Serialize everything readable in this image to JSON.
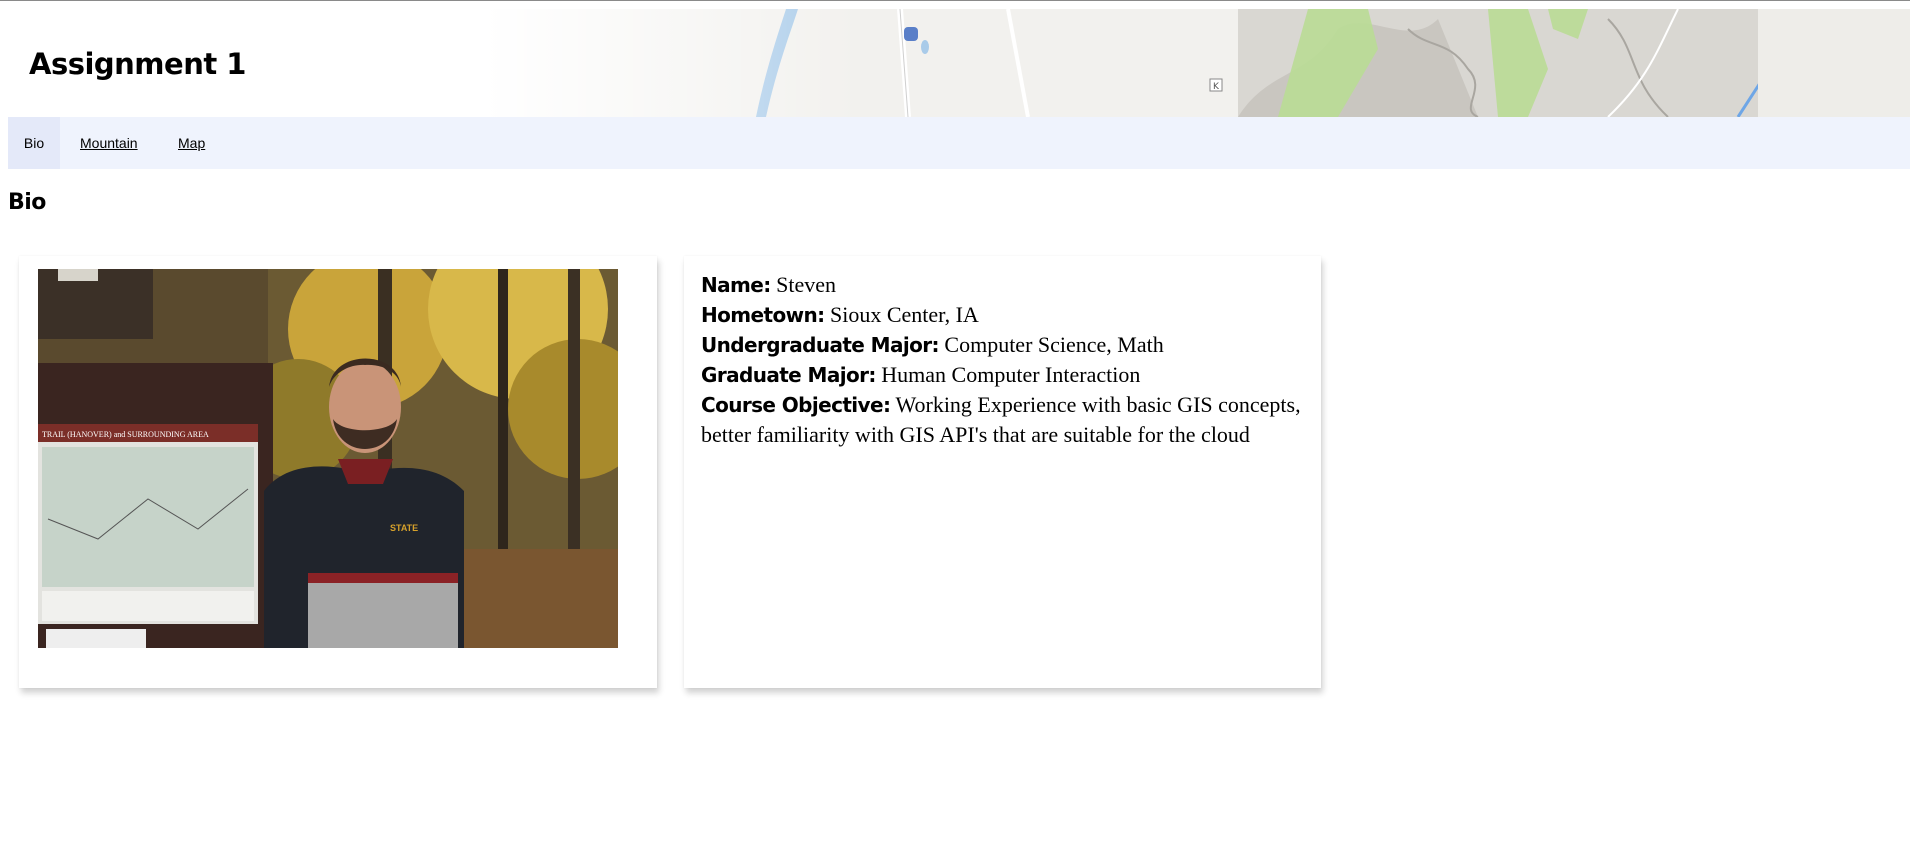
{
  "header": {
    "title": "Assignment 1",
    "map_label": "K"
  },
  "nav": {
    "items": [
      {
        "label": "Bio",
        "active": true
      },
      {
        "label": "Mountain",
        "active": false
      },
      {
        "label": "Map",
        "active": false
      }
    ]
  },
  "section": {
    "title": "Bio"
  },
  "bio": {
    "name_label": "Name:",
    "name_value": "Steven",
    "hometown_label": "Hometown:",
    "hometown_value": "Sioux Center, IA",
    "undergrad_label": "Undergraduate Major:",
    "undergrad_value": "Computer Science, Math",
    "grad_label": "Graduate Major:",
    "grad_value": "Human Computer Interaction",
    "objective_label": "Course Objective:",
    "objective_value": "Working Experience with basic GIS concepts, better familiarity with GIS API's that are suitable for the cloud"
  },
  "photo": {
    "sign_text": "TRAIL (HANOVER) and SURROUNDING AREA",
    "jacket_text": "STATE"
  },
  "colors": {
    "nav_bg": "#eff3fd",
    "nav_active_bg": "#e4e9f9",
    "map_green": "#b9dc95"
  }
}
